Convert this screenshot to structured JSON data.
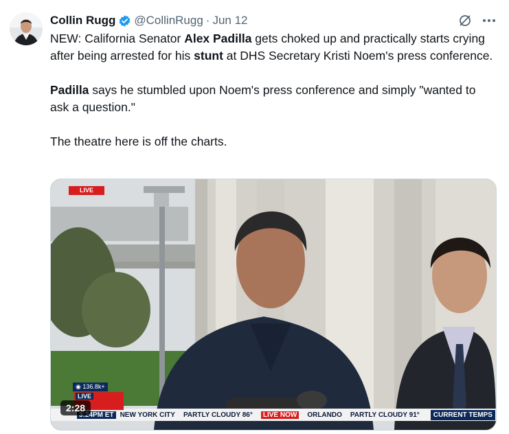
{
  "tweet": {
    "author_name": "Collin Rugg",
    "handle": "@CollinRugg",
    "separator": "·",
    "time": "Jun 12",
    "paragraphs": {
      "p1": {
        "a": "NEW: California Senator ",
        "b": "Alex Padilla",
        "c": " gets choked up and practically starts crying after being arrested for his ",
        "d": "stunt",
        "e": " at DHS Secretary Kristi Noem's press conference."
      },
      "p2": {
        "a": "Padilla",
        "b": " says he stumbled upon Noem's press conference and simply \"wanted to ask a question.\""
      },
      "p3": "The theatre here is off the charts."
    }
  },
  "video": {
    "live_badge": "LIVE",
    "viewers": "136.8k+",
    "live_now_label": "LIVE",
    "duration": "2:28",
    "ticker": {
      "time_text": "3:24PM ET",
      "city1": "NEW YORK CITY",
      "cond1": "PARTLY CLOUDY 86°",
      "now_logo": "LIVE NOW",
      "city2": "ORLANDO",
      "cond2": "PARTLY CLOUDY 91°",
      "current_temps": "CURRENT TEMPS"
    }
  },
  "colors": {
    "verified": "#1d9bf0",
    "text": "#0f1419",
    "secondary": "#536471",
    "live_red": "#d71d1d"
  }
}
